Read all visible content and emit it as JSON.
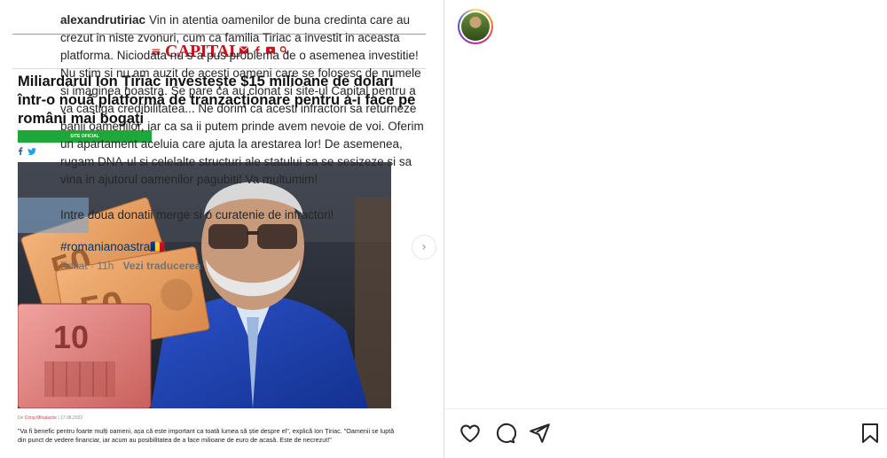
{
  "article": {
    "logo": "CAPITAL",
    "headline": "Miliardarul Ion Țiriac investește $15 milioane de dolari într-o nouă platformă de tranzacționare pentru a-i face pe români mai bogați",
    "badge": "SITE OFICIAL",
    "byline_prefix": "De",
    "byline_author": "Cring Mihalache",
    "byline_date": "| 17.08.2022",
    "quote": "\"Va fi benefic pentru foarte mulți oameni, așa că este important ca toată lumea să știe despre el\", explică Ion Țiriac. \"Oamenii se luptă din punct de vedere financiar, iar acum au posibilitatea de a face milioane de euro de acasă. Este de necrezut!\""
  },
  "post": {
    "username": "alexandrutiriac",
    "caption": "Vin in atentia oamenilor de buna credinta care au crezut in niste zvonuri, cum ca familia Tiriac a investit in aceasta platforma. Niciodata nu s-a pus problema de o asemenea investitie! Nu stim si nu am auzit de acesti oameni care se folosesc de numele si imaginea noastra. Se pare ca au clonat si site-ul Capital pentru a va castiga credibilitatea... Ne dorim ca acesti infractori sa returneze banii oamenilor, iar ca sa ii putem prinde avem nevoie de voi. Oferim un apartament aceluia care ajuta la arestarea lor! De asemenea, rugam DNA-ul si celelalte structuri ale statului sa se sesizeze si sa vina in ajutorul oamenilor pagubiti! Va multumim!\n\nIntre doua donatii merge si o curatenie de infractori!",
    "hashtag": "#romanianoastra🇷🇴",
    "edited": "Editat · 11h",
    "translate": "Vezi traducerea"
  },
  "icons": {
    "like": "heart-icon",
    "comment": "comment-icon",
    "share": "send-icon",
    "save": "bookmark-icon",
    "next": "chevron-right-icon"
  },
  "colors": {
    "capital_red": "#c4161c",
    "badge_green": "#1fa83a",
    "link_blue": "#00376b",
    "text": "#262626",
    "muted": "#737373"
  }
}
